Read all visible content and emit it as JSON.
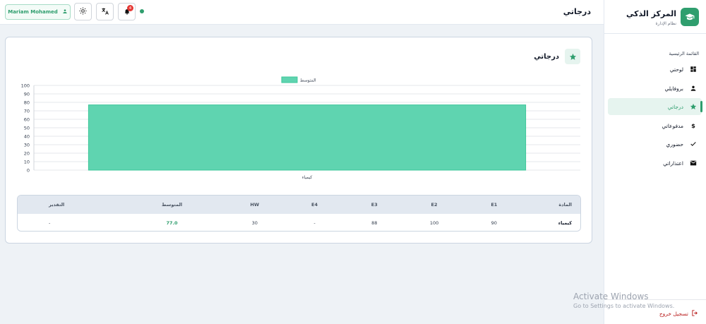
{
  "brand": {
    "title": "المركز الذكي",
    "subtitle": "نظام الإدارة"
  },
  "sidebar": {
    "section_label": "القائمة الرئيسية",
    "items": [
      {
        "label": "لوحتي",
        "icon": "dashboard-icon"
      },
      {
        "label": "بروفايلي",
        "icon": "person-icon"
      },
      {
        "label": "درجاتي",
        "icon": "star-icon",
        "active": true
      },
      {
        "label": "مدفوعاتي",
        "icon": "dollar-icon"
      },
      {
        "label": "حضوري",
        "icon": "check-icon"
      },
      {
        "label": "اعتذاراتي",
        "icon": "mail-icon"
      }
    ],
    "logout_label": "تسجيل خروج"
  },
  "header": {
    "title": "درجاتي",
    "user_name": "Mariam Mohamed",
    "notification_count": "4"
  },
  "card": {
    "title": "درجاتي"
  },
  "chart_data": {
    "type": "bar",
    "categories": [
      "كيمياء"
    ],
    "series": [
      {
        "name": "المتوسط",
        "values": [
          77.0
        ]
      }
    ],
    "ylim": [
      0,
      100
    ],
    "yticks": [
      0,
      10,
      20,
      30,
      40,
      50,
      60,
      70,
      80,
      90,
      100
    ],
    "legend": "top-center",
    "grid": true,
    "bar_color": "#5fd4b0"
  },
  "table": {
    "headers": {
      "subject": "المادة",
      "e1": "E1",
      "e2": "E2",
      "e3": "E3",
      "e4": "E4",
      "hw": "HW",
      "avg": "المتوسط",
      "grade": "التقدير"
    },
    "rows": [
      {
        "subject": "كيمياء",
        "e1": "90",
        "e2": "100",
        "e3": "88",
        "e4": "-",
        "hw": "30",
        "avg": "77.0",
        "grade": "-"
      }
    ]
  },
  "watermark": {
    "line1": "Activate Windows",
    "line2": "Go to Settings to activate Windows."
  },
  "colors": {
    "accent": "#2f9e6e",
    "badge": "#e53935",
    "logout": "#b91c1c"
  }
}
